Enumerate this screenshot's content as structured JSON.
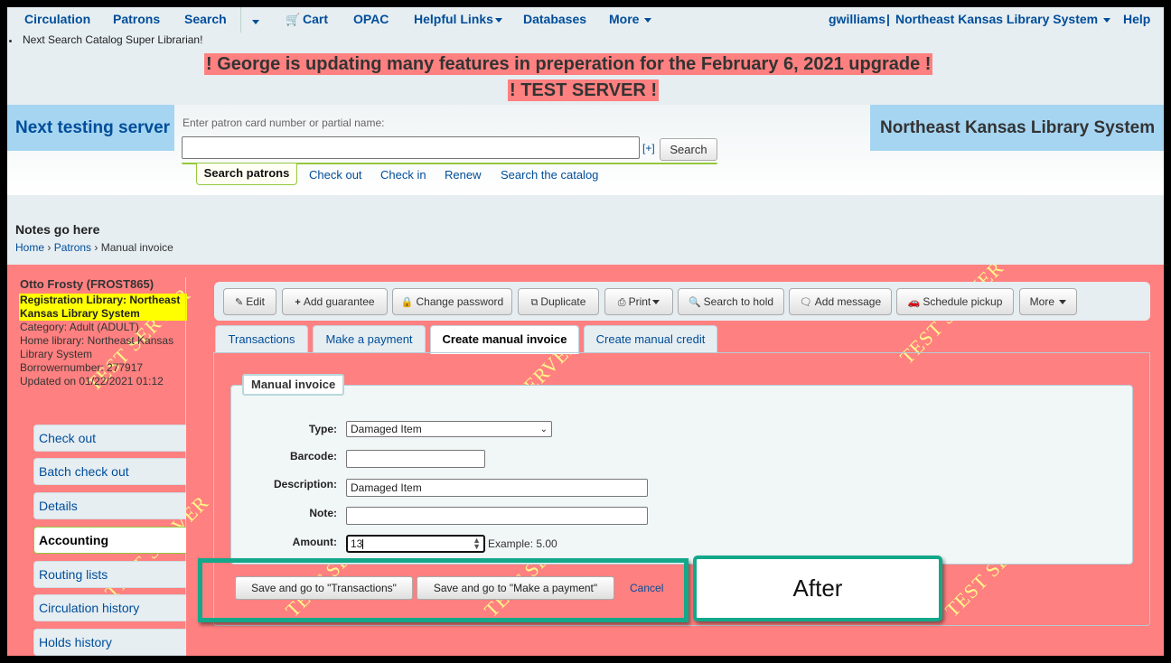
{
  "topnav": {
    "items": [
      "Circulation",
      "Patrons",
      "Search",
      "Cart",
      "OPAC",
      "Helpful Links",
      "Databases",
      "More"
    ],
    "user": "gwilliams",
    "separator": "|",
    "library": "Northeast Kansas Library System",
    "help": "Help"
  },
  "announcement": "Next Search Catalog Super Librarian!",
  "banners": {
    "line1": "! George is updating many features in preperation for the February 6, 2021 upgrade !",
    "line2": "! TEST SERVER !"
  },
  "header": {
    "left_logo": "Next testing server",
    "right_logo": "Northeast Kansas Library System",
    "search_label": "Enter patron card number or partial name:",
    "search_value": "",
    "plus_link": "[+]",
    "search_button": "Search",
    "search_tabs": [
      "Search patrons",
      "Check out",
      "Check in",
      "Renew",
      "Search the catalog"
    ]
  },
  "notes": "Notes go here",
  "breadcrumb": {
    "home": "Home",
    "patrons": "Patrons",
    "current": "Manual invoice",
    "sep": "›"
  },
  "patron": {
    "name": "Otto Frosty (FROST865)",
    "registration_library": "Registration Library: Northeast Kansas Library System",
    "category": "Category: Adult (ADULT)",
    "home_library": "Home library: Northeast Kansas Library System",
    "borrowernumber": "Borrowernumber: 277917",
    "updated": "Updated on 01/22/2021 01:12"
  },
  "sidebar": {
    "items": [
      {
        "label": "Check out",
        "active": false
      },
      {
        "label": "Batch check out",
        "active": false
      },
      {
        "label": "Details",
        "active": false
      },
      {
        "label": "Accounting",
        "active": true
      },
      {
        "label": "Routing lists",
        "active": false
      },
      {
        "label": "Circulation history",
        "active": false
      },
      {
        "label": "Holds history",
        "active": false
      }
    ]
  },
  "toolbar": {
    "edit": "Edit",
    "add_guarantee": "Add guarantee",
    "change_password": "Change password",
    "duplicate": "Duplicate",
    "print": "Print",
    "search_to_hold": "Search to hold",
    "add_message": "Add message",
    "schedule_pickup": "Schedule pickup",
    "more": "More"
  },
  "tabs": {
    "transactions": "Transactions",
    "make_payment": "Make a payment",
    "create_invoice": "Create manual invoice",
    "create_credit": "Create manual credit",
    "active": "Create manual invoice"
  },
  "form": {
    "legend": "Manual invoice",
    "type_label": "Type:",
    "type_value": "Damaged Item",
    "barcode_label": "Barcode:",
    "barcode_value": "",
    "description_label": "Description:",
    "description_value": "Damaged Item",
    "note_label": "Note:",
    "note_value": "",
    "amount_label": "Amount:",
    "amount_value": "13",
    "amount_example": "Example: 5.00"
  },
  "actions": {
    "save_transactions": "Save and go to \"Transactions\"",
    "save_payment": "Save and go to \"Make a payment\"",
    "cancel": "Cancel"
  },
  "annotation": {
    "label": "After",
    "color": "#13a88a"
  },
  "watermark_text": "TEST SERVER",
  "colors": {
    "test_server_bg": "#ff8080",
    "link": "#004d99",
    "highlight_yellow": "#ffff00",
    "accent_green": "#94c83d"
  }
}
